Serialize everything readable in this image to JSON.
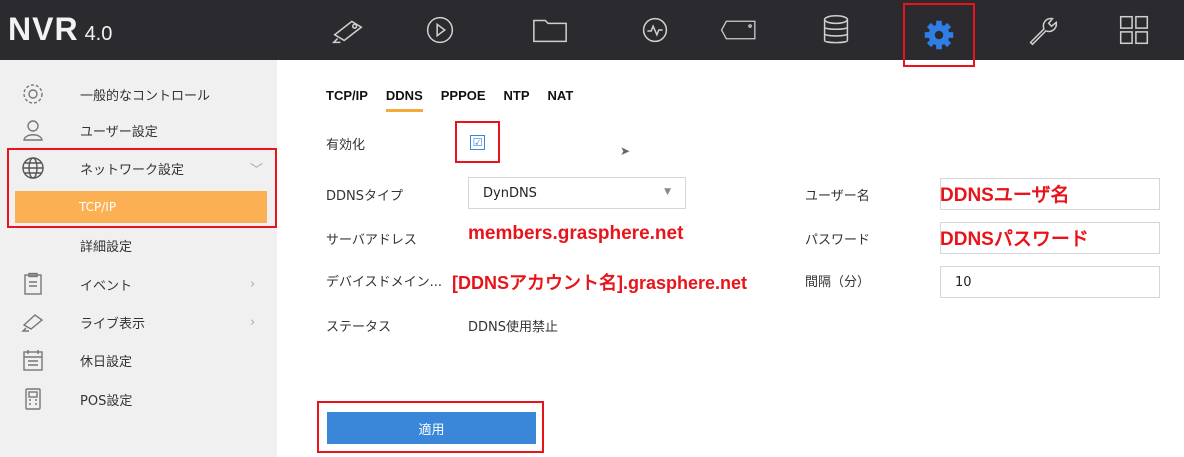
{
  "app": {
    "brand": "NVR",
    "version": "4.0"
  },
  "nav_icons": [
    "camera-icon",
    "playback-icon",
    "folder-icon",
    "analytics-icon",
    "tag-icon",
    "storage-icon",
    "gear-icon",
    "wrench-icon",
    "grid-icon"
  ],
  "sidebar": {
    "items": [
      {
        "label": "一般的なコントロール",
        "icon": "settings-icon"
      },
      {
        "label": "ユーザー設定",
        "icon": "user-icon"
      },
      {
        "label": "ネットワーク設定",
        "icon": "globe-icon",
        "chevron": "﹀"
      },
      {
        "label": "TCP/IP"
      },
      {
        "label": "詳細設定"
      },
      {
        "label": "イベント",
        "icon": "clipboard-icon",
        "chevron": "›"
      },
      {
        "label": "ライブ表示",
        "icon": "camera-icon",
        "chevron": "›"
      },
      {
        "label": "休日設定",
        "icon": "calendar-icon"
      },
      {
        "label": "POS設定",
        "icon": "pos-icon"
      }
    ]
  },
  "tabs": [
    "TCP/IP",
    "DDNS",
    "PPPOE",
    "NTP",
    "NAT"
  ],
  "form": {
    "enable_label": "有効化",
    "enable_checked": "☑",
    "ddns_type_label": "DDNSタイプ",
    "ddns_type_value": "DynDNS",
    "select_arrow": "▼",
    "server_label": "サーバアドレス",
    "server_value": "members.grasphere.net",
    "domain_label": "デバイスドメイン...",
    "domain_value": "[DDNSアカウント名].grasphere.net",
    "status_label": "ステータス",
    "status_value": "DDNS使用禁止",
    "user_label": "ユーザー名",
    "user_value": "DDNSユーザ名",
    "password_label": "パスワード",
    "password_value": "DDNSパスワード",
    "interval_label": "間隔（分）",
    "interval_value": "10",
    "apply_label": "適用"
  },
  "cursor": "➤"
}
